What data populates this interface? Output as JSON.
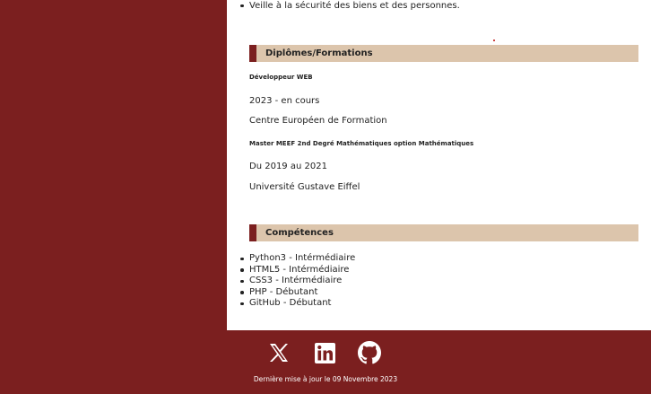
{
  "experience": {
    "bullets": [
      "Veille à la sécurité des biens et des personnes."
    ]
  },
  "diplomas": {
    "header": "Diplômes/Formations",
    "entries": [
      {
        "title": "Développeur WEB",
        "dates": "2023 - en cours",
        "institution": "Centre Européen de Formation"
      },
      {
        "title": "Master MEEF 2nd Degré Mathématiques option Mathématiques",
        "dates": "Du 2019 au 2021",
        "institution": "Université Gustave Eiffel"
      }
    ]
  },
  "skills": {
    "header": "Compétences",
    "items": [
      "Python3 - Intérmédiaire",
      "HTML5 - Intérmédiaire",
      "CSS3 - Intérmédiaire",
      "PHP - Débutant",
      "GitHub - Débutant"
    ]
  },
  "footer": {
    "icons": [
      "x-twitter-icon",
      "linkedin-icon",
      "github-icon"
    ],
    "last_update": "Dernière mise à jour le 09 Novembre 2023"
  },
  "colors": {
    "background": "#7b1f1f",
    "panel": "#ffffff",
    "section_header": "#dcc5ac",
    "accent": "#7b1f1f"
  }
}
